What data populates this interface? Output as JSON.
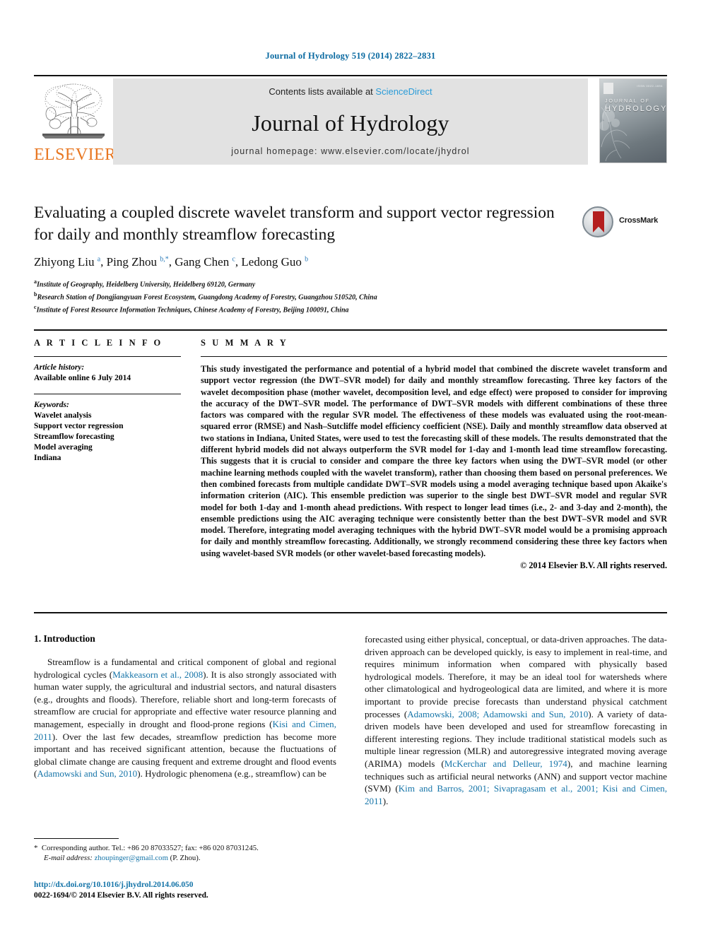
{
  "running_head": "Journal of Hydrology 519 (2014) 2822–2831",
  "masthead": {
    "publisher_name": "ELSEVIER",
    "contents_prefix": "Contents lists available at ",
    "contents_link": "ScienceDirect",
    "journal_name": "Journal of Hydrology",
    "homepage": "journal homepage: www.elsevier.com/locate/jhydrol",
    "cover": {
      "line1": "JOURNAL OF",
      "line2": "HYDROLOGY",
      "issn": "ISSN 0022-1694"
    }
  },
  "article": {
    "title": "Evaluating a coupled discrete wavelet transform and support vector regression for daily and monthly streamflow forecasting",
    "authors_html": "Zhiyong Liu <sup>a</sup>, Ping Zhou <sup>b,*</sup>, Gang Chen <sup>c</sup>, Ledong Guo <sup>b</sup>",
    "affiliations": [
      {
        "marker": "a",
        "text": "Institute of Geography, Heidelberg University, Heidelberg 69120, Germany"
      },
      {
        "marker": "b",
        "text": "Research Station of Dongjiangyuan Forest Ecosystem, Guangdong Academy of Forestry, Guangzhou 510520, China"
      },
      {
        "marker": "c",
        "text": "Institute of Forest Resource Information Techniques, Chinese Academy of Forestry, Beijing 100091, China"
      }
    ],
    "crossmark_label": "CrossMark"
  },
  "info": {
    "heading": "A R T I C L E   I N F O",
    "history_label": "Article history:",
    "history_value": "Available online 6 July 2014",
    "keywords_label": "Keywords:",
    "keywords": [
      "Wavelet analysis",
      "Support vector regression",
      "Streamflow forecasting",
      "Model averaging",
      "Indiana"
    ]
  },
  "summary": {
    "heading": "S U M M A R Y",
    "text": "This study investigated the performance and potential of a hybrid model that combined the discrete wavelet transform and support vector regression (the DWT–SVR model) for daily and monthly streamflow forecasting. Three key factors of the wavelet decomposition phase (mother wavelet, decomposition level, and edge effect) were proposed to consider for improving the accuracy of the DWT–SVR model. The performance of DWT–SVR models with different combinations of these three factors was compared with the regular SVR model. The effectiveness of these models was evaluated using the root-mean-squared error (RMSE) and Nash–Sutcliffe model efficiency coefficient (NSE). Daily and monthly streamflow data observed at two stations in Indiana, United States, were used to test the forecasting skill of these models. The results demonstrated that the different hybrid models did not always outperform the SVR model for 1-day and 1-month lead time streamflow forecasting. This suggests that it is crucial to consider and compare the three key factors when using the DWT–SVR model (or other machine learning methods coupled with the wavelet transform), rather than choosing them based on personal preferences. We then combined forecasts from multiple candidate DWT–SVR models using a model averaging technique based upon Akaike's information criterion (AIC). This ensemble prediction was superior to the single best DWT–SVR model and regular SVR model for both 1-day and 1-month ahead predictions. With respect to longer lead times (i.e., 2- and 3-day and 2-month), the ensemble predictions using the AIC averaging technique were consistently better than the best DWT–SVR model and SVR model. Therefore, integrating model averaging techniques with the hybrid DWT–SVR model would be a promising approach for daily and monthly streamflow forecasting. Additionally, we strongly recommend considering these three key factors when using wavelet-based SVR models (or other wavelet-based forecasting models).",
    "copyright": "© 2014 Elsevier B.V. All rights reserved."
  },
  "body": {
    "section_heading": "1. Introduction",
    "left_paragraph_html": "Streamflow is a fundamental and critical component of global and regional hydrological cycles (<span class=\"cite\">Makkeasorn et al., 2008</span>). It is also strongly associated with human water supply, the agricultural and industrial sectors, and natural disasters (e.g., droughts and floods). Therefore, reliable short and long-term forecasts of streamflow are crucial for appropriate and effective water resource planning and management, especially in drought and flood-prone regions (<span class=\"cite\">Kisi and Cimen, 2011</span>). Over the last few decades, streamflow prediction has become more important and has received significant attention, because the fluctuations of global climate change are causing frequent and extreme drought and flood events (<span class=\"cite\">Adamowski and Sun, 2010</span>). Hydrologic phenomena (e.g., streamflow) can be",
    "right_paragraph_html": "forecasted using either physical, conceptual, or data-driven approaches. The data-driven approach can be developed quickly, is easy to implement in real-time, and requires minimum information when compared with physically based hydrological models. Therefore, it may be an ideal tool for watersheds where other climatological and hydrogeological data are limited, and where it is more important to provide precise forecasts than understand physical catchment processes (<span class=\"cite\">Adamowski, 2008; Adamowski and Sun, 2010</span>). A variety of data-driven models have been developed and used for streamflow forecasting in different interesting regions. They include traditional statistical models such as multiple linear regression (MLR) and autoregressive integrated moving average (ARIMA) models (<span class=\"cite\">McKerchar and Delleur, 1974</span>), and machine learning techniques such as artificial neural networks (ANN) and support vector machine (SVM) (<span class=\"cite\">Kim and Barros, 2001; Sivapragasam et al., 2001; Kisi and Cimen, 2011</span>)."
  },
  "footnote": {
    "html": "<span class=\"star\">*</span>&nbsp; Corresponding author. Tel.: +86 20 87033527; fax: +86 020 87031245.<br><span style=\"margin-left:14px\"></span><em>E-mail address:</em> <span class=\"mail\">zhoupinger@gmail.com</span> (P. Zhou)."
  },
  "doi_block": {
    "doi": "http://dx.doi.org/10.1016/j.jhydrol.2014.06.050",
    "issn_line": "0022-1694/© 2014 Elsevier B.V. All rights reserved."
  },
  "colors": {
    "link_blue": "#1574a8",
    "sciencedirect_blue": "#2b9cd8",
    "running_head_blue": "#0a6aa1",
    "elsevier_orange": "#e87722",
    "crossmark_red": "#b41f1f"
  }
}
